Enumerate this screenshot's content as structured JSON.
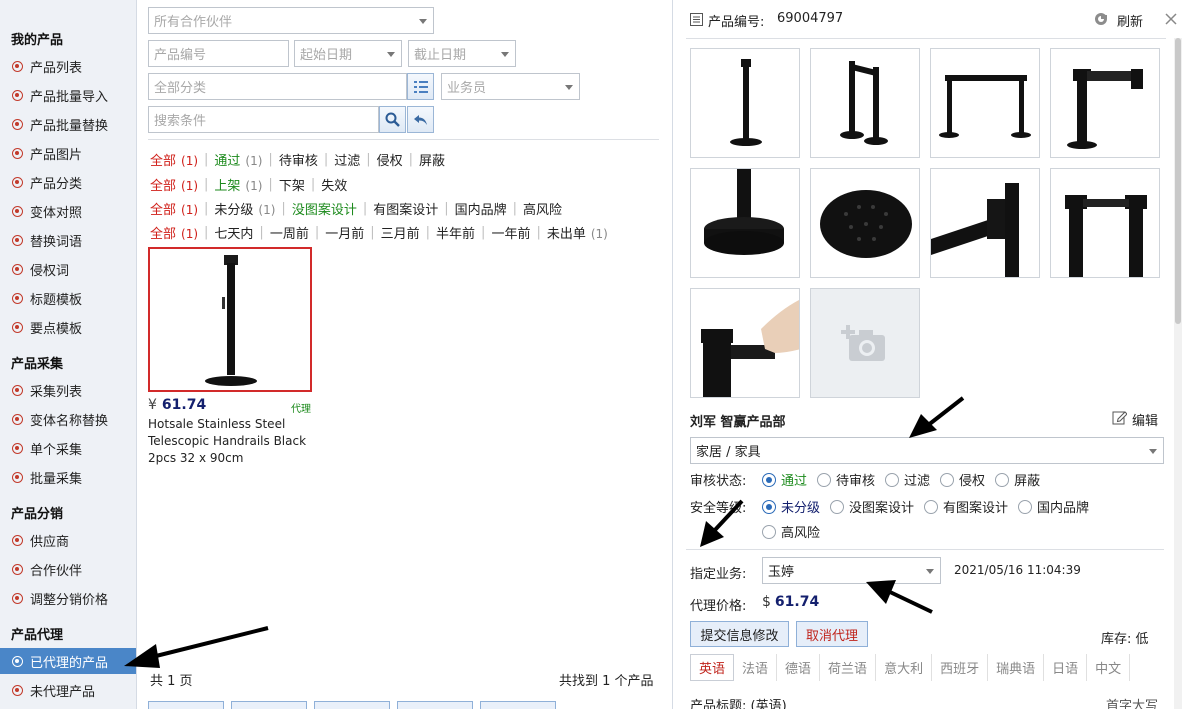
{
  "sidebar": {
    "groups": [
      {
        "title": "我的产品",
        "items": [
          "产品列表",
          "产品批量导入",
          "产品批量替换",
          "产品图片",
          "产品分类",
          "变体对照",
          "替换词语",
          "侵权词",
          "标题模板",
          "要点模板"
        ]
      },
      {
        "title": "产品采集",
        "items": [
          "采集列表",
          "变体名称替换",
          "单个采集",
          "批量采集"
        ]
      },
      {
        "title": "产品分销",
        "items": [
          "供应商",
          "合作伙伴",
          "调整分销价格"
        ]
      },
      {
        "title": "产品代理",
        "items": [
          "已代理的产品",
          "未代理产品"
        ]
      }
    ],
    "active_item": "已代理的产品"
  },
  "filters": {
    "partner_placeholder": "所有合作伙伴",
    "product_no_placeholder": "产品编号",
    "start_date_placeholder": "起始日期",
    "end_date_placeholder": "截止日期",
    "category_placeholder": "全部分类",
    "salesman_placeholder": "业务员",
    "search_placeholder": "搜索条件"
  },
  "filter_rows": [
    [
      {
        "label": "全部",
        "count": "(1)",
        "style": "red"
      },
      {
        "label": "通过",
        "count": "(1)",
        "style": "green"
      },
      {
        "label": "待审核"
      },
      {
        "label": "过滤"
      },
      {
        "label": "侵权"
      },
      {
        "label": "屏蔽"
      }
    ],
    [
      {
        "label": "全部",
        "count": "(1)",
        "style": "red"
      },
      {
        "label": "上架",
        "count": "(1)",
        "style": "green"
      },
      {
        "label": "下架"
      },
      {
        "label": "失效"
      }
    ],
    [
      {
        "label": "全部",
        "count": "(1)",
        "style": "red"
      },
      {
        "label": "未分级",
        "count": "(1)"
      },
      {
        "label": "没图案设计",
        "style": "green"
      },
      {
        "label": "有图案设计"
      },
      {
        "label": "国内品牌"
      },
      {
        "label": "高风险"
      }
    ],
    [
      {
        "label": "全部",
        "count": "(1)",
        "style": "red"
      },
      {
        "label": "七天内"
      },
      {
        "label": "一周前"
      },
      {
        "label": "一月前"
      },
      {
        "label": "三月前"
      },
      {
        "label": "半年前"
      },
      {
        "label": "一年前"
      },
      {
        "label": "未出单",
        "count": "(1)"
      }
    ]
  ],
  "product": {
    "currency": "¥",
    "price": "61.74",
    "tag": "代理",
    "title": "Hotsale Stainless Steel Telescopic Handrails Black 2pcs 32 x 90cm"
  },
  "list_footer": {
    "pages": "共 1 页",
    "found": "共找到 1 个产品"
  },
  "detail": {
    "product_no_label": "产品编号:",
    "product_no": "69004797",
    "refresh": "刷新",
    "owner": "刘军 智赢产品部",
    "edit": "编辑",
    "category": "家居 / 家具",
    "review_label": "审核状态:",
    "review_options": [
      "通过",
      "待审核",
      "过滤",
      "侵权",
      "屏蔽"
    ],
    "review_selected": "通过",
    "safety_label": "安全等级:",
    "safety_options": [
      "未分级",
      "没图案设计",
      "有图案设计",
      "国内品牌",
      "高风险"
    ],
    "safety_selected": "未分级",
    "assign_label": "指定业务:",
    "assignee": "玉婷",
    "assign_time": "2021/05/16 11:04:39",
    "agent_price_label": "代理价格:",
    "agent_price_currency": "$",
    "agent_price": "61.74",
    "submit_btn": "提交信息修改",
    "cancel_btn": "取消代理",
    "stock": "库存: 低",
    "languages": [
      "英语",
      "法语",
      "德语",
      "荷兰语",
      "意大利",
      "西班牙",
      "瑞典语",
      "日语",
      "中文"
    ],
    "current_language": "英语",
    "title_label": "产品标题: (英语)",
    "caps_hint": "首字大写"
  },
  "colors": {
    "accent": "#4a86c8",
    "alert": "#d0201a",
    "ok": "#1c8a1c",
    "price": "#14206e"
  }
}
